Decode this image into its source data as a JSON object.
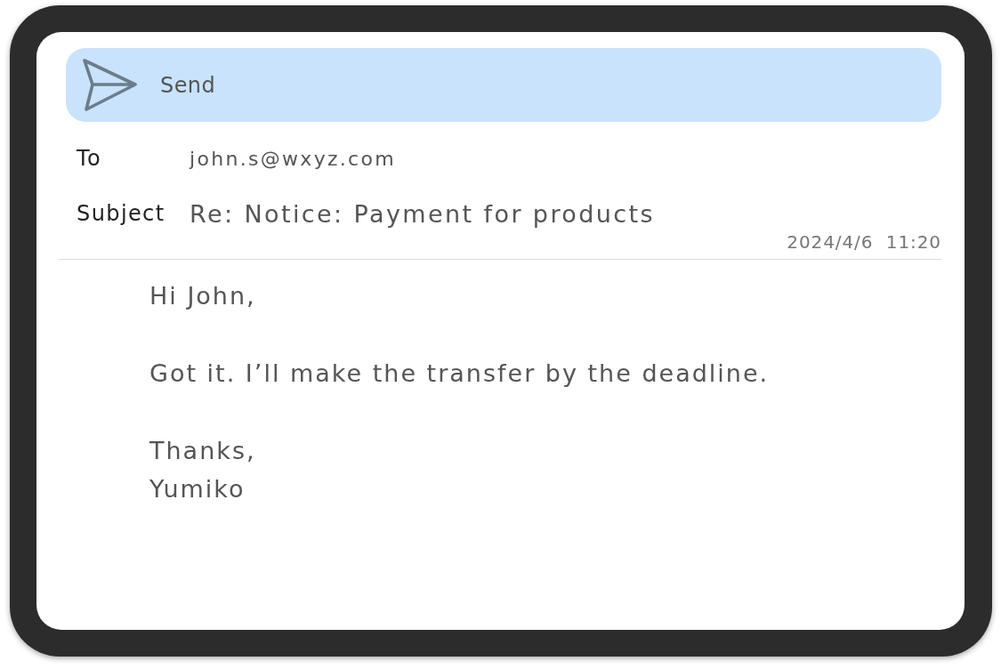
{
  "toolbar": {
    "send_label": "Send"
  },
  "fields": [
    {
      "kind": "recipient",
      "label": "To",
      "value": "john.s@wxyz.com"
    },
    {
      "kind": "subject",
      "label": "Subject",
      "value": "Re: Notice: Payment for products"
    }
  ],
  "timestamp": "2024/4/6  11:20",
  "body": {
    "paragraphs": [
      [
        "Hi John,"
      ],
      [
        "Got it. I’ll make the transfer by the deadline."
      ],
      [
        "Thanks,",
        "Yumiko"
      ]
    ]
  }
}
